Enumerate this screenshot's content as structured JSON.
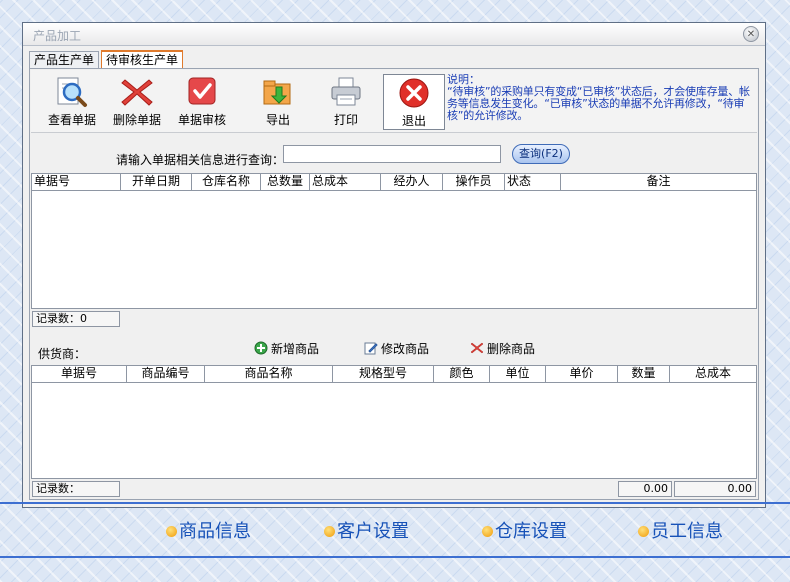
{
  "window": {
    "title": "产品加工"
  },
  "tabs": [
    {
      "label": "产品生产单"
    },
    {
      "label": "待审核生产单"
    }
  ],
  "toolbar": {
    "view_label": "查看单据",
    "delete_label": "删除单据",
    "audit_label": "单据审核",
    "export_label": "导出",
    "print_label": "打印",
    "exit_label": "退出"
  },
  "note": {
    "title": "说明：",
    "body": "“待审核”的采购单只有变成“已审核”状态后，才会使库存量、帐务等信息发生变化。“已审核”状态的单据不允许再修改，“待审核”的允许修改。"
  },
  "search": {
    "label": "请输入单据相关信息进行查询：",
    "value": "",
    "button": "查询(F2)"
  },
  "orders_grid": {
    "columns": [
      "单据号",
      "开单日期",
      "仓库名称",
      "总数量",
      "总成本",
      "经办人",
      "操作员",
      "状态",
      "备注"
    ],
    "count_label": "记录数：0"
  },
  "supplier": {
    "label": "供货商："
  },
  "item_actions": {
    "add": "新增商品",
    "edit": "修改商品",
    "delete": "删除商品"
  },
  "items_grid": {
    "columns": [
      "单据号",
      "商品编号",
      "商品名称",
      "规格型号",
      "颜色",
      "单位",
      "单价",
      "数量",
      "总成本"
    ],
    "count_label": "记录数：",
    "qty_total": "0.00",
    "cost_total": "0.00"
  },
  "bottom_nav": [
    {
      "label": "商品信息"
    },
    {
      "label": "客户设置"
    },
    {
      "label": "仓库设置"
    },
    {
      "label": "员工信息"
    }
  ],
  "colors": {
    "note_text": "#1a3db5",
    "nav_text": "#1752b8",
    "active_tab": "#e07a2c"
  }
}
